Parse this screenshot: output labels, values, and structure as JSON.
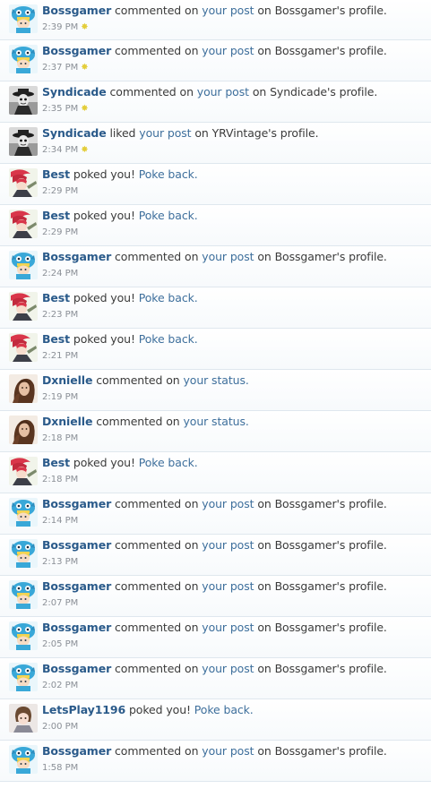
{
  "notifications": [
    {
      "avatar": "bossgamer",
      "user": "Bossgamer",
      "action": "commented on",
      "link": "your post",
      "suffix": "on Bossgamer's profile.",
      "time": "2:39 PM",
      "new": true
    },
    {
      "avatar": "bossgamer",
      "user": "Bossgamer",
      "action": "commented on",
      "link": "your post",
      "suffix": "on Bossgamer's profile.",
      "time": "2:37 PM",
      "new": true
    },
    {
      "avatar": "syndicade",
      "user": "Syndicade",
      "action": "commented on",
      "link": "your post",
      "suffix": "on Syndicade's profile.",
      "time": "2:35 PM",
      "new": true
    },
    {
      "avatar": "syndicade",
      "user": "Syndicade",
      "action": "liked",
      "link": "your post",
      "suffix": "on YRVintage's profile.",
      "time": "2:34 PM",
      "new": true
    },
    {
      "avatar": "best",
      "user": "Best",
      "action": "poked you!",
      "link": "Poke back.",
      "suffix": "",
      "time": "2:29 PM",
      "new": false
    },
    {
      "avatar": "best",
      "user": "Best",
      "action": "poked you!",
      "link": "Poke back.",
      "suffix": "",
      "time": "2:29 PM",
      "new": false
    },
    {
      "avatar": "bossgamer",
      "user": "Bossgamer",
      "action": "commented on",
      "link": "your post",
      "suffix": "on Bossgamer's profile.",
      "time": "2:24 PM",
      "new": false
    },
    {
      "avatar": "best",
      "user": "Best",
      "action": "poked you!",
      "link": "Poke back.",
      "suffix": "",
      "time": "2:23 PM",
      "new": false
    },
    {
      "avatar": "best",
      "user": "Best",
      "action": "poked you!",
      "link": "Poke back.",
      "suffix": "",
      "time": "2:21 PM",
      "new": false
    },
    {
      "avatar": "dxnielle",
      "user": "Dxnielle",
      "action": "commented on",
      "link": "your status.",
      "suffix": "",
      "time": "2:19 PM",
      "new": false
    },
    {
      "avatar": "dxnielle",
      "user": "Dxnielle",
      "action": "commented on",
      "link": "your status.",
      "suffix": "",
      "time": "2:18 PM",
      "new": false
    },
    {
      "avatar": "best",
      "user": "Best",
      "action": "poked you!",
      "link": "Poke back.",
      "suffix": "",
      "time": "2:18 PM",
      "new": false
    },
    {
      "avatar": "bossgamer",
      "user": "Bossgamer",
      "action": "commented on",
      "link": "your post",
      "suffix": "on Bossgamer's profile.",
      "time": "2:14 PM",
      "new": false
    },
    {
      "avatar": "bossgamer",
      "user": "Bossgamer",
      "action": "commented on",
      "link": "your post",
      "suffix": "on Bossgamer's profile.",
      "time": "2:13 PM",
      "new": false
    },
    {
      "avatar": "bossgamer",
      "user": "Bossgamer",
      "action": "commented on",
      "link": "your post",
      "suffix": "on Bossgamer's profile.",
      "time": "2:07 PM",
      "new": false
    },
    {
      "avatar": "bossgamer",
      "user": "Bossgamer",
      "action": "commented on",
      "link": "your post",
      "suffix": "on Bossgamer's profile.",
      "time": "2:05 PM",
      "new": false
    },
    {
      "avatar": "bossgamer",
      "user": "Bossgamer",
      "action": "commented on",
      "link": "your post",
      "suffix": "on Bossgamer's profile.",
      "time": "2:02 PM",
      "new": false
    },
    {
      "avatar": "letsplay",
      "user": "LetsPlay1196",
      "action": "poked you!",
      "link": "Poke back.",
      "suffix": "",
      "time": "2:00 PM",
      "new": false
    },
    {
      "avatar": "bossgamer",
      "user": "Bossgamer",
      "action": "commented on",
      "link": "your post",
      "suffix": "on Bossgamer's profile.",
      "time": "1:58 PM",
      "new": false
    }
  ],
  "new_indicator_icon": "sparkle-icon",
  "colors": {
    "username": "#2a5a8a",
    "link": "#3e6f9c",
    "text": "#3b3b3b",
    "time": "#8a8f96",
    "new_indicator": "#e3cd39",
    "divider": "#dfe7ee"
  }
}
